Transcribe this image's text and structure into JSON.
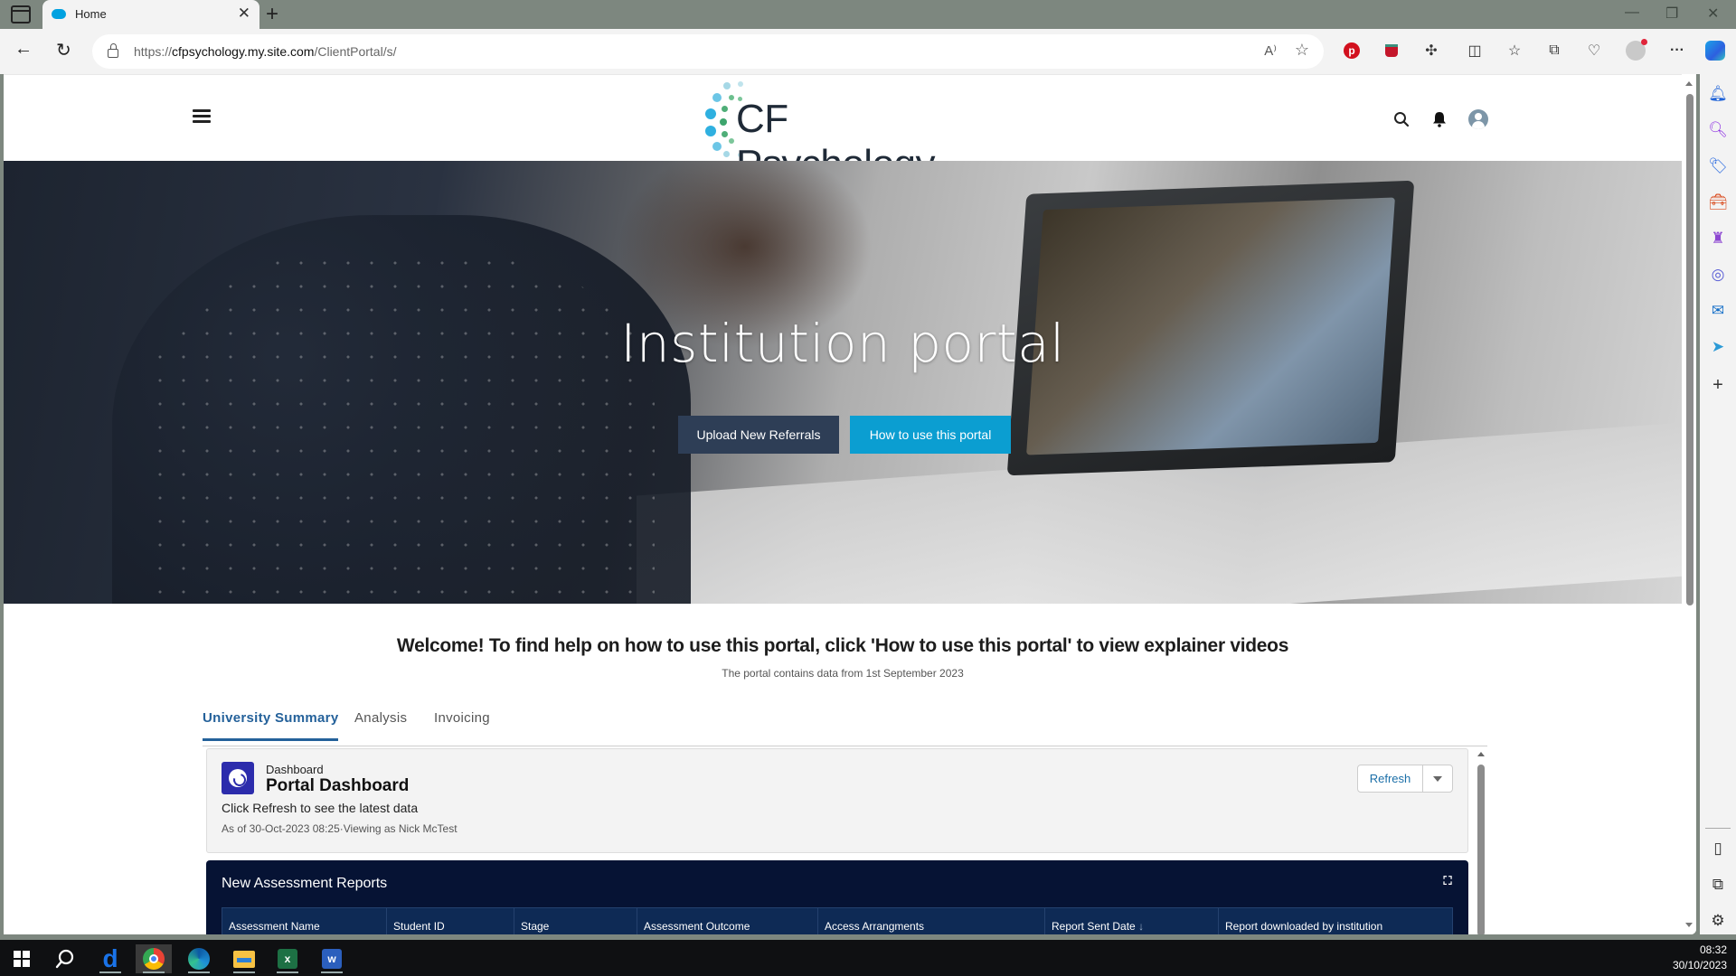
{
  "browser": {
    "tab_title": "Home",
    "url_prefix": "https://",
    "url_domain": "cfpsychology.my.site.com",
    "url_path": "/ClientPortal/s/",
    "icons": {
      "read_aloud": "read-aloud-icon",
      "favorite": "star-icon",
      "pinterest": "pinterest-icon",
      "extension_red": "shield-extension-icon",
      "extensions": "puzzle-icon",
      "split_screen": "split-screen-icon",
      "favorites": "favorites-list-icon",
      "collections": "collections-icon",
      "browser_essentials": "heart-pulse-icon",
      "profile": "profile-icon",
      "more": "ellipsis-icon",
      "copilot": "copilot-icon"
    }
  },
  "site": {
    "brand_name": "CF Psychology",
    "header_icons": [
      "search-icon",
      "bell-icon",
      "user-avatar-icon"
    ]
  },
  "hero": {
    "title": "Institution portal",
    "buttons": {
      "upload": "Upload New Referrals",
      "howto": "How to use this portal"
    }
  },
  "content": {
    "welcome": "Welcome! To find help on how to use this portal, click 'How to use this portal' to view explainer videos",
    "subnote": "The portal contains data from 1st September 2023",
    "tabs": [
      {
        "label": "University Summary",
        "active": true
      },
      {
        "label": "Analysis",
        "active": false
      },
      {
        "label": "Invoicing",
        "active": false
      }
    ]
  },
  "dashboard": {
    "type_label": "Dashboard",
    "title": "Portal Dashboard",
    "hint": "Click Refresh to see the latest data",
    "meta": "As of 30-Oct-2023 08:25·Viewing as Nick McTest",
    "refresh_label": "Refresh"
  },
  "reports": {
    "title": "New Assessment Reports",
    "columns": [
      "Assessment Name",
      "Student ID",
      "Stage",
      "Assessment Outcome",
      "Access Arrangments",
      "Report Sent Date",
      "Report downloaded by institution"
    ],
    "sort_indicator": "↓",
    "sorted_column": "Report Sent Date"
  },
  "taskbar": {
    "time": "08:32",
    "date": "30/10/2023",
    "apps": [
      "start",
      "search",
      "dialpad",
      "chrome",
      "edge",
      "file-explorer",
      "excel",
      "word"
    ]
  }
}
